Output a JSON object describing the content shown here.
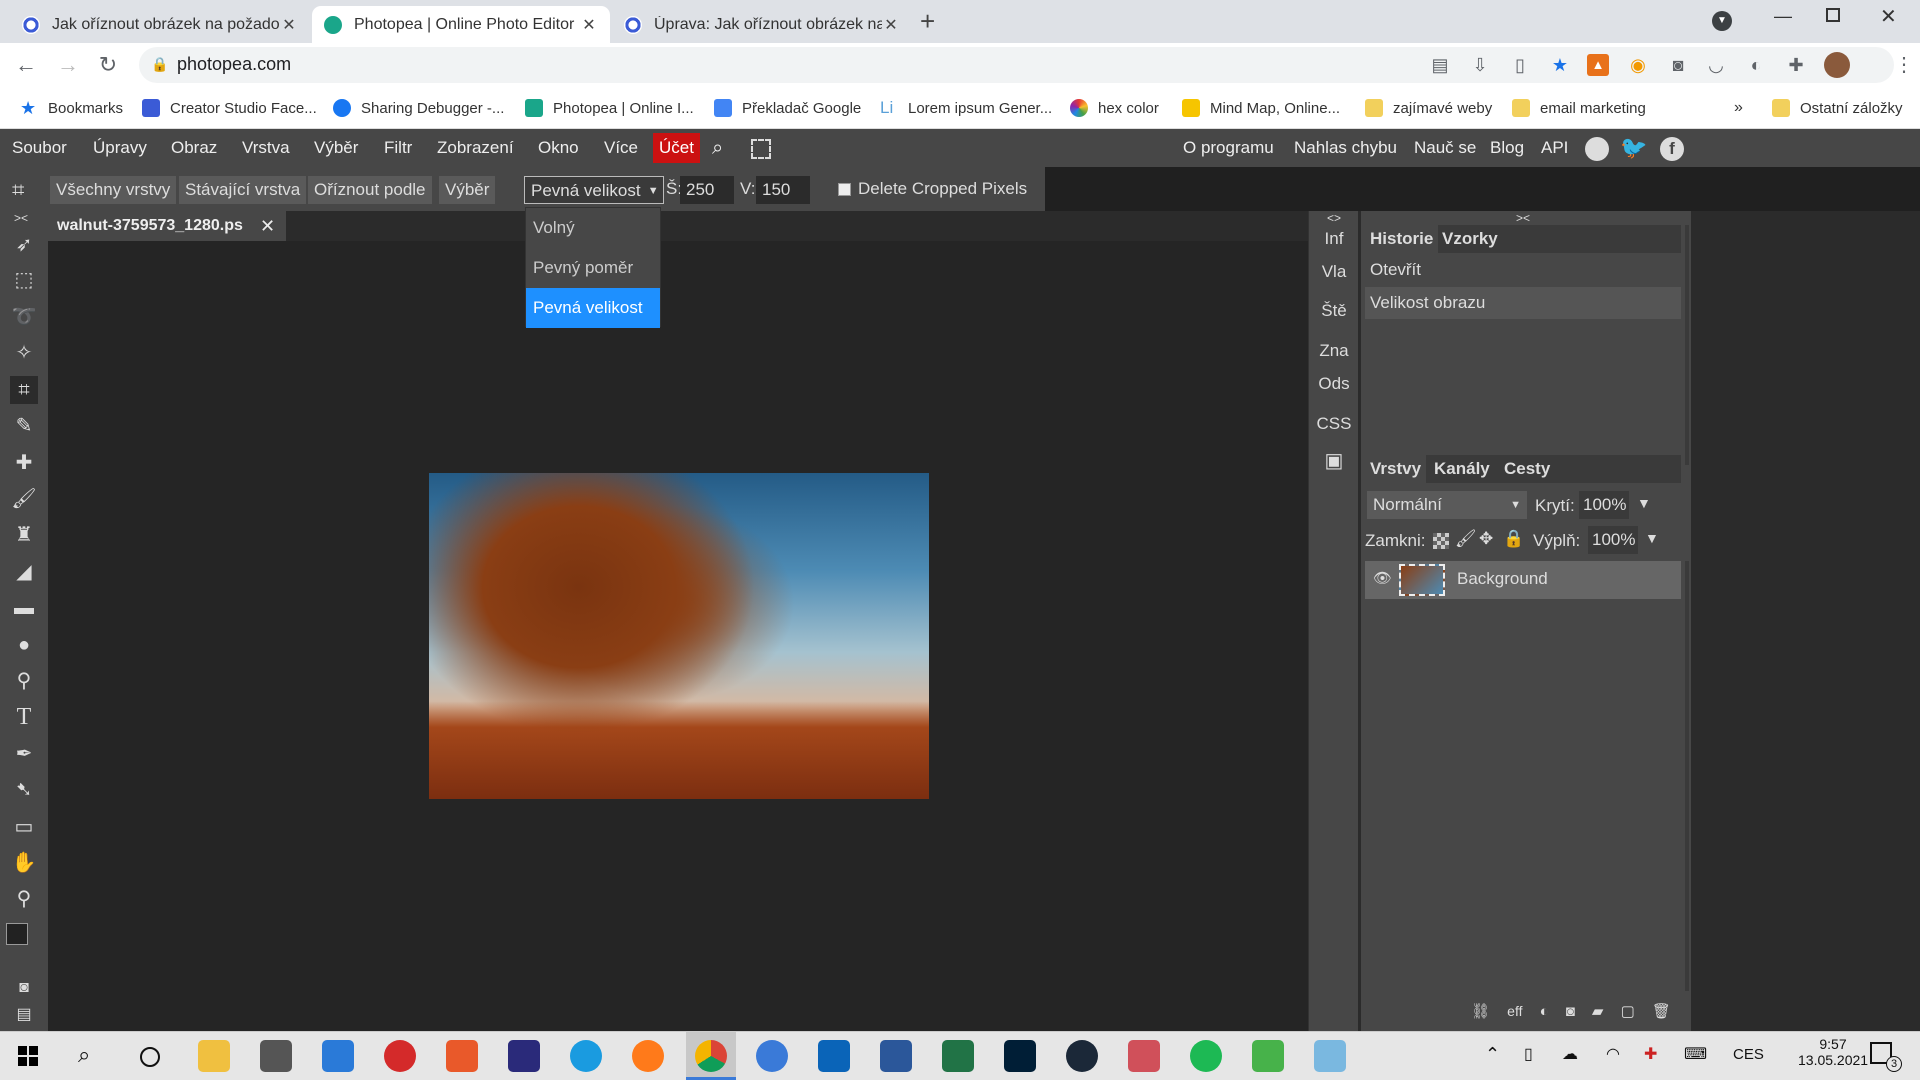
{
  "tabs": [
    {
      "title": "Jak oříznout obrázek na požadov",
      "active": false
    },
    {
      "title": "Photopea | Online Photo Editor",
      "active": true
    },
    {
      "title": "Úprava: Jak oříznout obrázek na",
      "active": false
    }
  ],
  "address": {
    "url": "photopea.com"
  },
  "bookmarks": [
    "Bookmarks",
    "Creator Studio Face...",
    "Sharing Debugger -...",
    "Photopea | Online I...",
    "Překladač Google",
    "Lorem ipsum Gener...",
    "hex color",
    "Mind Map, Online...",
    "zajímavé weby",
    "email marketing",
    "Ostatní záložky"
  ],
  "menu": [
    "Soubor",
    "Úpravy",
    "Obraz",
    "Vrstva",
    "Výběr",
    "Filtr",
    "Zobrazení",
    "Okno",
    "Více",
    "Účet"
  ],
  "right_menu": [
    "O programu",
    "Nahlas chybu",
    "Nauč se",
    "Blog",
    "API"
  ],
  "options": {
    "all_layers": "Všechny vrstvy",
    "current_layer": "Stávající vrstva",
    "crop_by": "Oříznout podle",
    "selection": "Výběr",
    "mode": "Pevná velikost",
    "w_label": "Š:",
    "w_value": "250",
    "h_label": "V:",
    "h_value": "150",
    "delete_cropped": "Delete Cropped Pixels"
  },
  "dropdown": {
    "items": [
      "Volný",
      "Pevný poměr",
      "Pevná velikost"
    ],
    "selected": "Pevná velikost"
  },
  "document": {
    "tab": "walnut-3759573_1280.ps"
  },
  "minipanel": [
    "Inf",
    "Vla",
    "Ště",
    "Zna",
    "Ods",
    "CSS"
  ],
  "history": {
    "tabs": [
      "Historie",
      "Vzorky"
    ],
    "items": [
      "Otevřít",
      "Velikost obrazu"
    ]
  },
  "layers": {
    "tabs": [
      "Vrstvy",
      "Kanály",
      "Cesty"
    ],
    "blend": "Normální",
    "opacity_label": "Krytí:",
    "opacity": "100%",
    "lock_label": "Zamkni:",
    "fill_label": "Výplň:",
    "fill": "100%",
    "layer_name": "Background"
  },
  "taskbar": {
    "lang": "CES",
    "time": "9:57",
    "date": "13.05.2021",
    "notif": "3"
  },
  "colors": {
    "accent": "#1e90ff",
    "account": "#cc1111"
  }
}
